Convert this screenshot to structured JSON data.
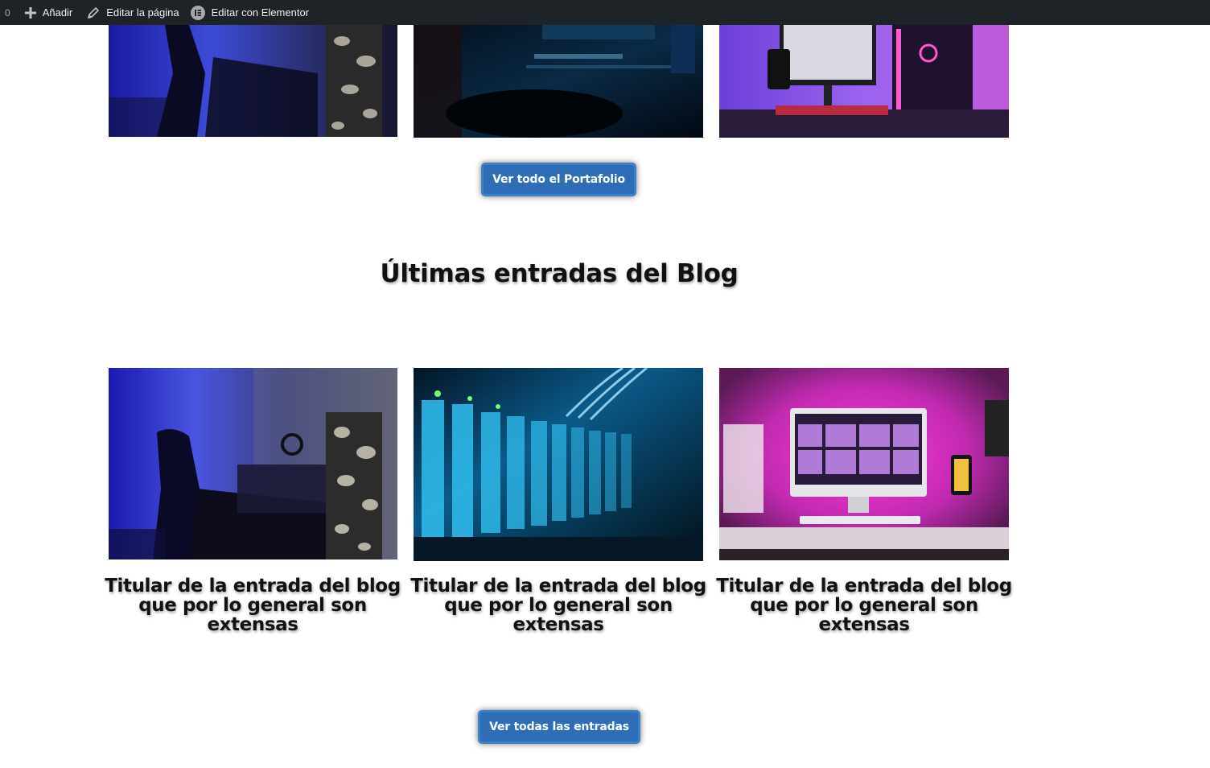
{
  "adminbar": {
    "count": "0",
    "add_label": "Añadir",
    "edit_page_label": "Editar la página",
    "elementor_label": "Editar con Elementor"
  },
  "portfolio": {
    "images": [
      {
        "alt": "gaming-room-blue"
      },
      {
        "alt": "gaming-chair-dark-blue"
      },
      {
        "alt": "gaming-desk-purple"
      }
    ],
    "button_label": "Ver todo el Portafolio"
  },
  "blog": {
    "heading": "Últimas entradas del Blog",
    "posts": [
      {
        "title": "Titular de la entrada del blog que por lo general son extensas"
      },
      {
        "title": "Titular de la entrada del blog que por lo general son extensas"
      },
      {
        "title": "Titular de la entrada del blog que por lo general son extensas"
      }
    ],
    "button_label": "Ver todas las entradas"
  },
  "colors": {
    "adminbar_bg": "#1d2327",
    "button_bg": "#2f6eb7",
    "heading_text": "#111111"
  }
}
